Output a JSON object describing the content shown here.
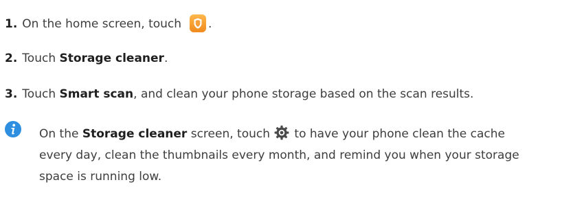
{
  "steps": [
    {
      "number": "1.",
      "text": "On the home screen, touch",
      "after_icon": ".",
      "icon": "phone-manager-shield-icon"
    },
    {
      "number": "2.",
      "prefix": "Touch ",
      "bold": "Storage cleaner",
      "suffix": "."
    },
    {
      "number": "3.",
      "prefix": "Touch ",
      "bold": "Smart scan",
      "suffix": ", and clean your phone storage based on the scan results."
    }
  ],
  "note": {
    "icon": "info-icon",
    "prefix": "On the ",
    "bold": "Storage cleaner",
    "middle": " screen, touch",
    "gear_icon": "gear-icon",
    "suffix": " to have your phone clean the cache every day, clean the thumbnails every month, and remind you when your storage space is running low."
  },
  "colors": {
    "text": "#3d3d3d",
    "bold_text": "#1f1f1f",
    "shield_icon": "#f59a2e",
    "info_icon": "#2e8ee0"
  }
}
